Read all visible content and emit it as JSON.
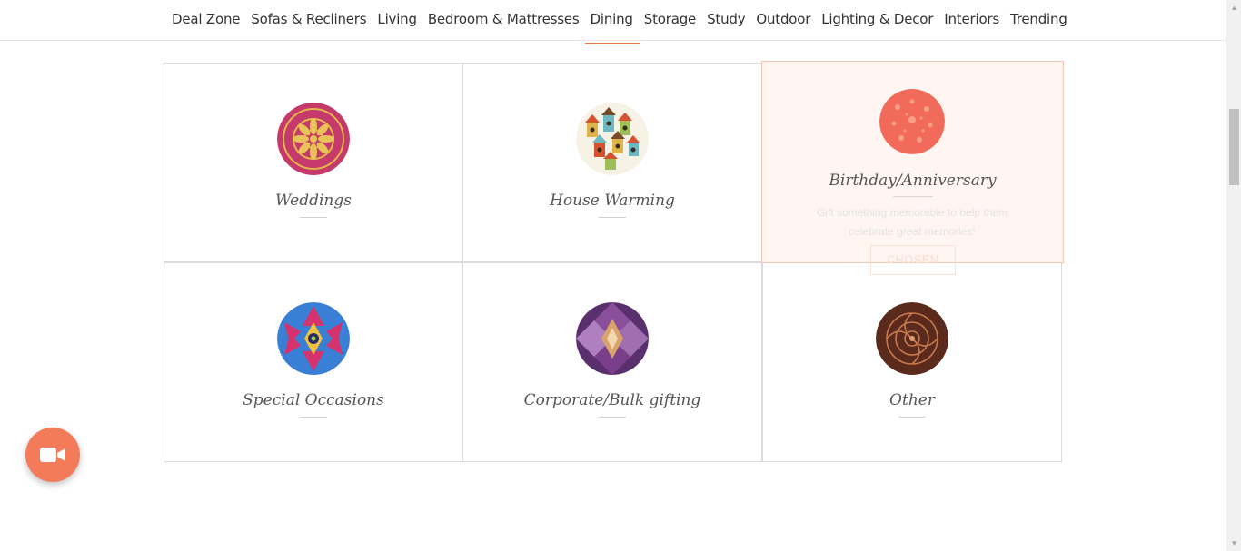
{
  "nav": {
    "items": [
      "Deal Zone",
      "Sofas & Recliners",
      "Living",
      "Bedroom & Mattresses",
      "Dining",
      "Storage",
      "Study",
      "Outdoor",
      "Lighting & Decor",
      "Interiors",
      "Trending"
    ],
    "active": "Dining",
    "accent_color": "#e2764f"
  },
  "occasions": [
    {
      "title": "Weddings",
      "icon": "mandala-pattern-icon"
    },
    {
      "title": "House Warming",
      "icon": "birdhouses-icon"
    },
    {
      "title": "Birthday/Anniversary",
      "icon": "coral-pattern-icon",
      "description": "Gift something memorable to help them celebrate great memories!",
      "button": "CHOSEN"
    },
    {
      "title": "Special Occasions",
      "icon": "kaleidoscope-icon"
    },
    {
      "title": "Corporate/Bulk gifting",
      "icon": "geometric-purple-icon"
    },
    {
      "title": "Other",
      "icon": "paisley-brown-icon"
    }
  ],
  "floating_button": {
    "icon": "video-camera-icon",
    "color": "#f47b5a"
  }
}
